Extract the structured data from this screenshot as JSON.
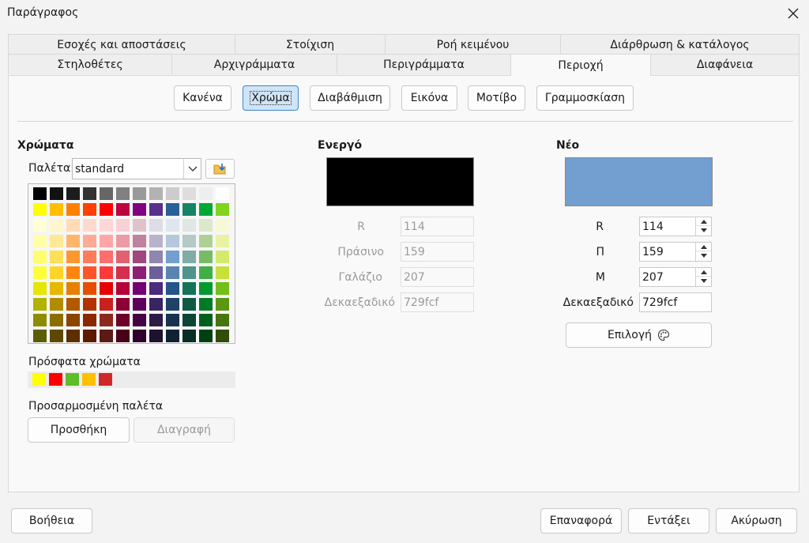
{
  "window": {
    "title": "Παράγραφος"
  },
  "tabs_row1": [
    "Εσοχές και αποστάσεις",
    "Στοίχιση",
    "Ροή κειμένου",
    "Διάρθρωση & κατάλογος"
  ],
  "tabs_row2": [
    "Στηλοθέτες",
    "Αρχιγράμματα",
    "Περιγράμματα",
    "Περιοχή",
    "Διαφάνεια"
  ],
  "active_tab": "Περιοχή",
  "fill_buttons": [
    "Κανένα",
    "Χρώμα",
    "Διαβάθμιση",
    "Εικόνα",
    "Μοτίβο",
    "Γραμμοσκίαση"
  ],
  "active_fill": "Χρώμα",
  "colors_section": {
    "heading": "Χρώματα",
    "palette_label": "Παλέτα:",
    "palette_value": "standard",
    "recent_label": "Πρόσφατα χρώματα",
    "custom_label": "Προσαρμοσμένη παλέτα",
    "add_label": "Προσθήκη",
    "delete_label": "Διαγραφή",
    "recent_colors": [
      "#ffff00",
      "#ff0000",
      "#5ebd2a",
      "#ffc000",
      "#d02828"
    ],
    "palette_rows": [
      [
        "#000000",
        "#111111",
        "#1c1c1c",
        "#333333",
        "#666666",
        "#808080",
        "#999999",
        "#b2b2b2",
        "#cccccc",
        "#dddddd",
        "#eeeeee",
        "#ffffff"
      ],
      [
        "#ffff00",
        "#ffbf00",
        "#ff8000",
        "#ff4000",
        "#ff0000",
        "#bf0041",
        "#800080",
        "#55308d",
        "#2a6099",
        "#158466",
        "#00a933",
        "#81d41a"
      ],
      [
        "#ffffd7",
        "#fff5ce",
        "#ffdbb6",
        "#ffd8ce",
        "#ffd7d7",
        "#f7d1d5",
        "#e0c2cd",
        "#dedce6",
        "#dee6ef",
        "#dee7e5",
        "#dde8cb",
        "#f6f9d4"
      ],
      [
        "#ffffa6",
        "#ffe994",
        "#ffb66c",
        "#ffaa95",
        "#ffa6a6",
        "#ec9ba4",
        "#bf819e",
        "#b7b3ca",
        "#b4c7dc",
        "#b3cac7",
        "#afd095",
        "#e8f2a1"
      ],
      [
        "#ffff6d",
        "#ffde59",
        "#ff972f",
        "#ff7b59",
        "#ff6d6d",
        "#e16173",
        "#a1467e",
        "#8e86ae",
        "#729fcf",
        "#81aca6",
        "#77bc65",
        "#d4ea6b"
      ],
      [
        "#ffff38",
        "#ffd428",
        "#ff860d",
        "#ff5429",
        "#ff3838",
        "#d62e4e",
        "#8d1d75",
        "#6b5e9b",
        "#5983b0",
        "#50938a",
        "#3faf46",
        "#c9e03b"
      ],
      [
        "#e6e600",
        "#e6b800",
        "#e68000",
        "#e64d00",
        "#e60000",
        "#b60038",
        "#740074",
        "#4a2b7d",
        "#245489",
        "#127358",
        "#009a2e",
        "#73be18"
      ],
      [
        "#b2b200",
        "#b28c00",
        "#b25900",
        "#b23300",
        "#c9211e",
        "#8d0031",
        "#5c005c",
        "#3a245f",
        "#1e4268",
        "#0e5944",
        "#007a24",
        "#5d9612"
      ],
      [
        "#8c8c00",
        "#8c6d00",
        "#8c4500",
        "#8c2800",
        "#8d281e",
        "#6d0026",
        "#460046",
        "#2c1b47",
        "#173350",
        "#0b4535",
        "#00601c",
        "#48750e"
      ],
      [
        "#5c5c00",
        "#5c4800",
        "#5c2e00",
        "#5c1a00",
        "#5c1a14",
        "#480019",
        "#2e002e",
        "#1d1230",
        "#0f2234",
        "#072e23",
        "#004013",
        "#304d09"
      ]
    ]
  },
  "active_section": {
    "heading": "Ενεργό",
    "color": "#000000",
    "r_label": "R",
    "r_value": "114",
    "g_label": "Πράσινο",
    "g_value": "159",
    "b_label": "Γαλάζιο",
    "b_value": "207",
    "hex_label": "Δεκαεξαδικό",
    "hex_value": "729fcf"
  },
  "new_section": {
    "heading": "Νέο",
    "color": "#729fcf",
    "r_label": "R",
    "r_value": "114",
    "g_label": "Π",
    "g_value": "159",
    "b_label": "Μ",
    "b_value": "207",
    "hex_label": "Δεκαεξαδικό",
    "hex_value": "729fcf",
    "pick_label": "Επιλογή"
  },
  "footer": {
    "help_label": "Βοήθεια",
    "reset_label": "Επαναφορά",
    "ok_label": "Εντάξει",
    "cancel_label": "Ακύρωση"
  }
}
